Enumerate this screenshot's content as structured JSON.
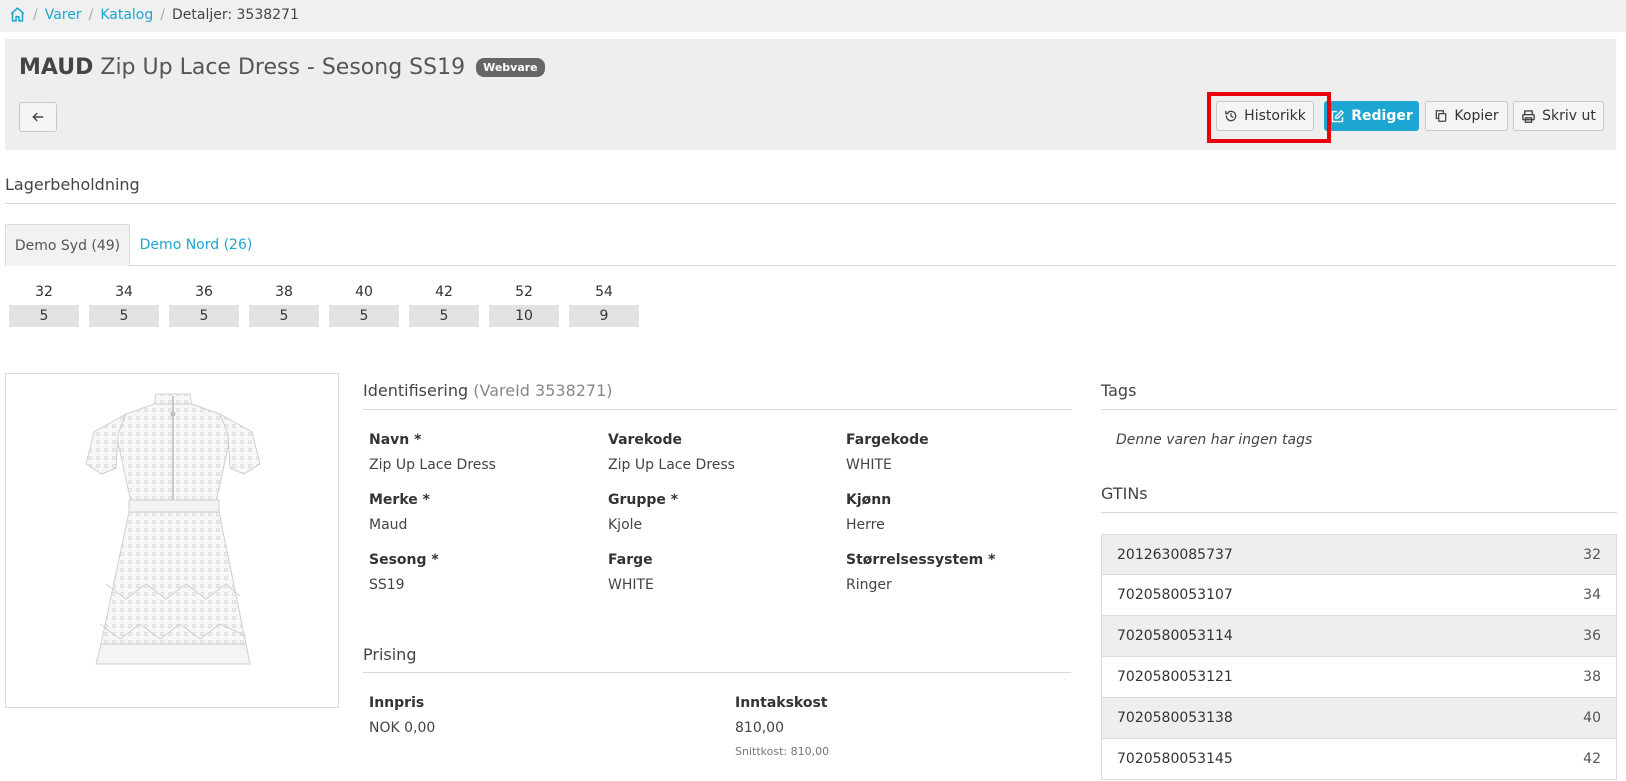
{
  "breadcrumb": {
    "items": [
      "Varer",
      "Katalog"
    ],
    "current": "Detaljer: 3538271"
  },
  "product": {
    "brand": "MAUD",
    "title": "Zip Up Lace Dress - Sesong SS19",
    "badge": "Webvare"
  },
  "toolbar": {
    "history_label": "Historikk",
    "edit_label": "Rediger",
    "copy_label": "Kopier",
    "print_label": "Skriv ut"
  },
  "stock": {
    "heading": "Lagerbeholdning",
    "tabs": [
      {
        "label": "Demo Syd (49)",
        "active": true
      },
      {
        "label": "Demo Nord (26)",
        "active": false
      }
    ],
    "sizes": [
      {
        "size": "32",
        "qty": "5"
      },
      {
        "size": "34",
        "qty": "5"
      },
      {
        "size": "36",
        "qty": "5"
      },
      {
        "size": "38",
        "qty": "5"
      },
      {
        "size": "40",
        "qty": "5"
      },
      {
        "size": "42",
        "qty": "5"
      },
      {
        "size": "52",
        "qty": "10"
      },
      {
        "size": "54",
        "qty": "9"
      }
    ]
  },
  "identification": {
    "heading": "Identifisering",
    "heading_sub": "(VareId 3538271)",
    "fields": [
      {
        "label": "Navn *",
        "value": "Zip Up Lace Dress"
      },
      {
        "label": "Varekode",
        "value": "Zip Up Lace Dress"
      },
      {
        "label": "Fargekode",
        "value": "WHITE"
      },
      {
        "label": "Merke *",
        "value": "Maud"
      },
      {
        "label": "Gruppe *",
        "value": "Kjole"
      },
      {
        "label": "Kjønn",
        "value": "Herre"
      },
      {
        "label": "Sesong *",
        "value": "SS19"
      },
      {
        "label": "Farge",
        "value": "WHITE"
      },
      {
        "label": "Størrelsessystem *",
        "value": "Ringer"
      }
    ]
  },
  "pricing": {
    "heading": "Prising",
    "fields": [
      {
        "label": "Innpris",
        "value": "NOK 0,00"
      },
      {
        "label": "Inntakskost",
        "value": "810,00",
        "note": "Snittkost: 810,00"
      }
    ]
  },
  "tags": {
    "heading": "Tags",
    "empty_text": "Denne varen har ingen tags"
  },
  "gtins": {
    "heading": "GTINs",
    "rows": [
      {
        "code": "2012630085737",
        "size": "32"
      },
      {
        "code": "7020580053107",
        "size": "34"
      },
      {
        "code": "7020580053114",
        "size": "36"
      },
      {
        "code": "7020580053121",
        "size": "38"
      },
      {
        "code": "7020580053138",
        "size": "40"
      },
      {
        "code": "7020580053145",
        "size": "42"
      }
    ]
  },
  "colors": {
    "accent": "#1ea6d3",
    "highlight": "#e8000b"
  }
}
